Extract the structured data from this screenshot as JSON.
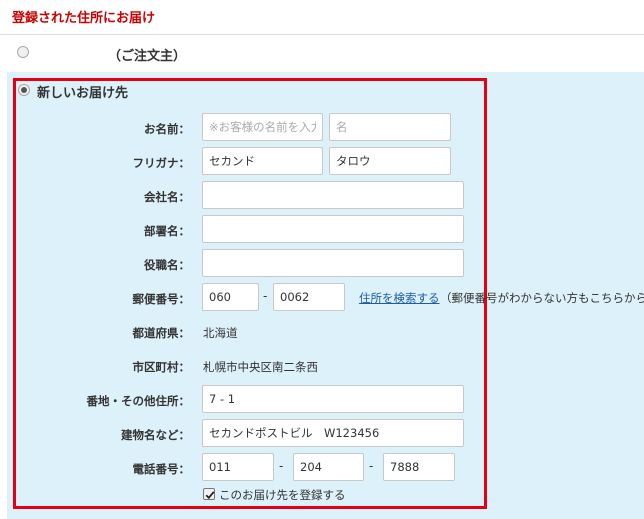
{
  "section": {
    "title": "登録された住所にお届け"
  },
  "order_option": {
    "label": "（ご注文主）"
  },
  "new_address": {
    "label": "新しいお届け先",
    "name": {
      "label": "お名前：",
      "last_placeholder": "※お客様の名前を入力",
      "first_placeholder": "名"
    },
    "kana": {
      "label": "フリガナ：",
      "last": "セカンド",
      "first": "タロウ"
    },
    "company": {
      "label": "会社名：",
      "value": ""
    },
    "department": {
      "label": "部署名：",
      "value": ""
    },
    "position": {
      "label": "役職名：",
      "value": ""
    },
    "postal": {
      "label": "郵便番号：",
      "part1": "060",
      "dash": "-",
      "part2": "0062",
      "search_link": "住所を検索する",
      "search_note": "（郵便番号がわからない方もこちらから）"
    },
    "prefecture": {
      "label": "都道府県：",
      "value": "北海道"
    },
    "city": {
      "label": "市区町村：",
      "value": "札幌市中央区南二条西"
    },
    "street": {
      "label": "番地・その他住所：",
      "value": "7 - 1"
    },
    "building": {
      "label": "建物名など：",
      "value": "セカンドポストビル　W123456"
    },
    "phone": {
      "label": "電話番号：",
      "part1": "011",
      "dash1": "-",
      "part2": "204",
      "dash2": "-",
      "part3": "7888"
    },
    "register": {
      "label": "このお届け先を登録する",
      "checked": true
    }
  },
  "colors": {
    "title": "#cc0000",
    "panel_bg": "#ddf1fa",
    "highlight_border": "#e60012",
    "link": "#1a5dab"
  }
}
